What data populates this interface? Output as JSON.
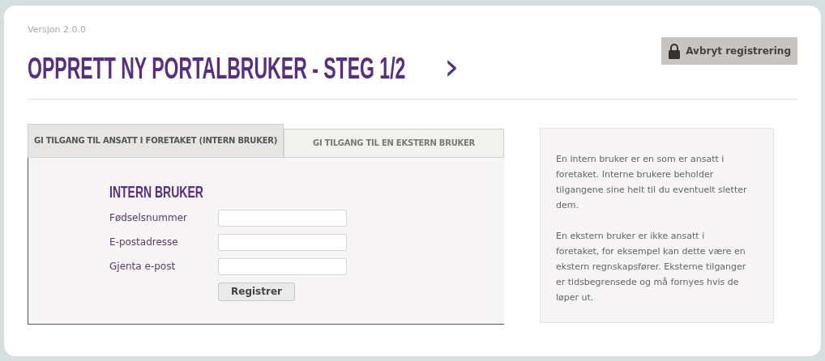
{
  "version": "Versjon 2.0.0",
  "title": "OPPRETT NY PORTALBRUKER - STEG 1/2",
  "next_arrow": "›",
  "cancel_button": "Avbryt registrering",
  "tabs": [
    {
      "label": "GI TILGANG TIL ANSATT I FORETAKET (INTERN BRUKER)",
      "selected": true
    },
    {
      "label": "GI TILGANG TIL EN EKSTERN BRUKER",
      "selected": false
    }
  ],
  "form": {
    "heading": "INTERN BRUKER",
    "fields": [
      {
        "label": "Fødselsnummer"
      },
      {
        "label": "E-postadresse"
      },
      {
        "label": "Gjenta e-post"
      }
    ],
    "submit": "Registrer"
  },
  "info": [
    "En intern bruker er en som er ansatt i foretaket. Interne brukere beholder tilgangene sine helt til du eventuelt sletter dem.",
    "En ekstern bruker er ikke ansatt i foretaket, for eksempel kan dette være en ekstern regnskapsfører. Eksterne tilganger er tidsbegrensede og må fornyes hvis de løper ut."
  ]
}
